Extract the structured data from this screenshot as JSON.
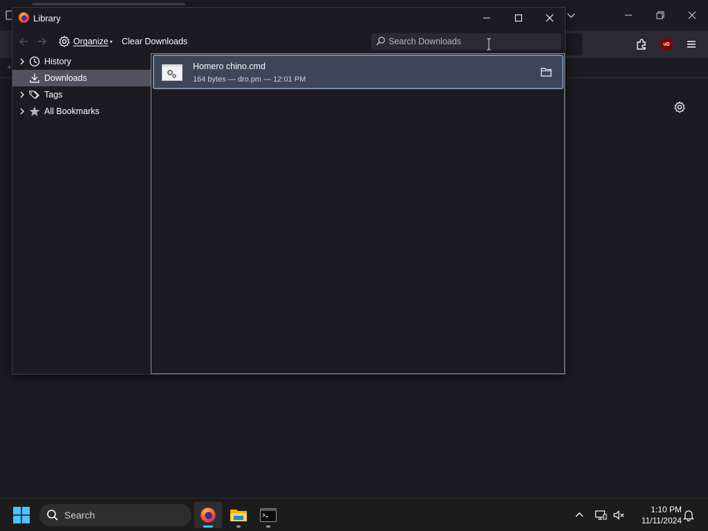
{
  "library": {
    "title": "Library",
    "toolbar": {
      "organize_label": "Organize",
      "clear_downloads_label": "Clear Downloads",
      "search_placeholder": "Search Downloads",
      "search_value": ""
    },
    "sidebar": {
      "items": [
        {
          "label": "History",
          "icon": "clock-icon",
          "expandable": true,
          "selected": false
        },
        {
          "label": "Downloads",
          "icon": "download-icon",
          "expandable": false,
          "selected": true
        },
        {
          "label": "Tags",
          "icon": "tags-icon",
          "expandable": true,
          "selected": false
        },
        {
          "label": "All Bookmarks",
          "icon": "star-icon",
          "expandable": true,
          "selected": false
        }
      ]
    },
    "downloads": [
      {
        "file_name": "Homero chino.cmd",
        "meta": "164 bytes — dro.pm — 12:01 PM",
        "icon": "settings-file-icon",
        "action_icon": "folder-icon"
      }
    ]
  },
  "browser": {
    "extension_badge": "uD"
  },
  "taskbar": {
    "search_label": "Search",
    "apps": [
      "firefox",
      "file-explorer",
      "terminal"
    ],
    "clock": {
      "time": "1:10 PM",
      "date": "11/11/2024"
    }
  },
  "colors": {
    "window_bg": "#1c1b22",
    "toolbar_bg": "#2b2a33",
    "selected_row": "#52525e",
    "download_item_bg": "#3d4558",
    "download_item_border": "#7a8ba6",
    "taskbar_bg": "#1c1c1c",
    "active_indicator": "#4cc2ff"
  }
}
